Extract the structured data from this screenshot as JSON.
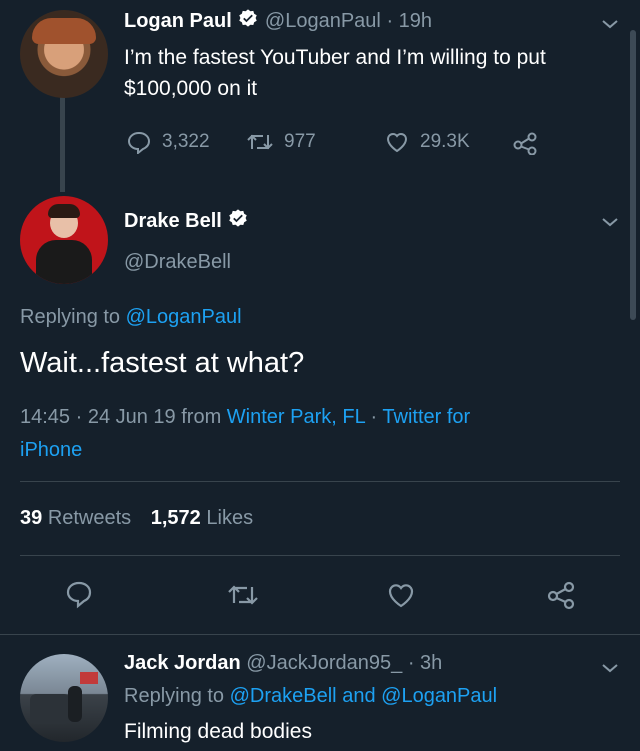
{
  "tweet1": {
    "name": "Logan Paul",
    "handle": "@LoganPaul",
    "time": "· 19h",
    "text_line1": "I’m the fastest YouTuber and I’m willing to put",
    "text_line2": "$100,000 on it",
    "replies": "3,322",
    "retweets": "977",
    "likes": "29.3K"
  },
  "tweet2": {
    "name": "Drake Bell",
    "handle": "@DrakeBell",
    "replying_prefix": "Replying to",
    "replying_to": "@LoganPaul",
    "text": "Wait...fastest at what?",
    "meta_time": "14:45 · 24 Jun 19 from",
    "location": "Winter Park, FL",
    "meta_sep": "·",
    "source_line1": "Twitter for",
    "source_line2": "iPhone",
    "retweet_count": "39",
    "retweet_label": "Retweets",
    "like_count": "1,572",
    "like_label": "Likes"
  },
  "tweet3": {
    "name": "Jack Jordan",
    "handle": "@JackJordan95_",
    "time": "· 3h",
    "replying_prefix": "Replying to",
    "replying_to_1": "@DrakeBell",
    "and": "and",
    "replying_to_2": "@LoganPaul",
    "text": "Filming dead bodies"
  },
  "colors": {
    "background": "#15202b",
    "muted": "#8899a6",
    "accent": "#1da1f2",
    "divider": "#38444d"
  },
  "icons": [
    "verified-badge-icon",
    "chevron-down-icon",
    "reply-icon",
    "retweet-icon",
    "like-icon",
    "share-icon"
  ]
}
